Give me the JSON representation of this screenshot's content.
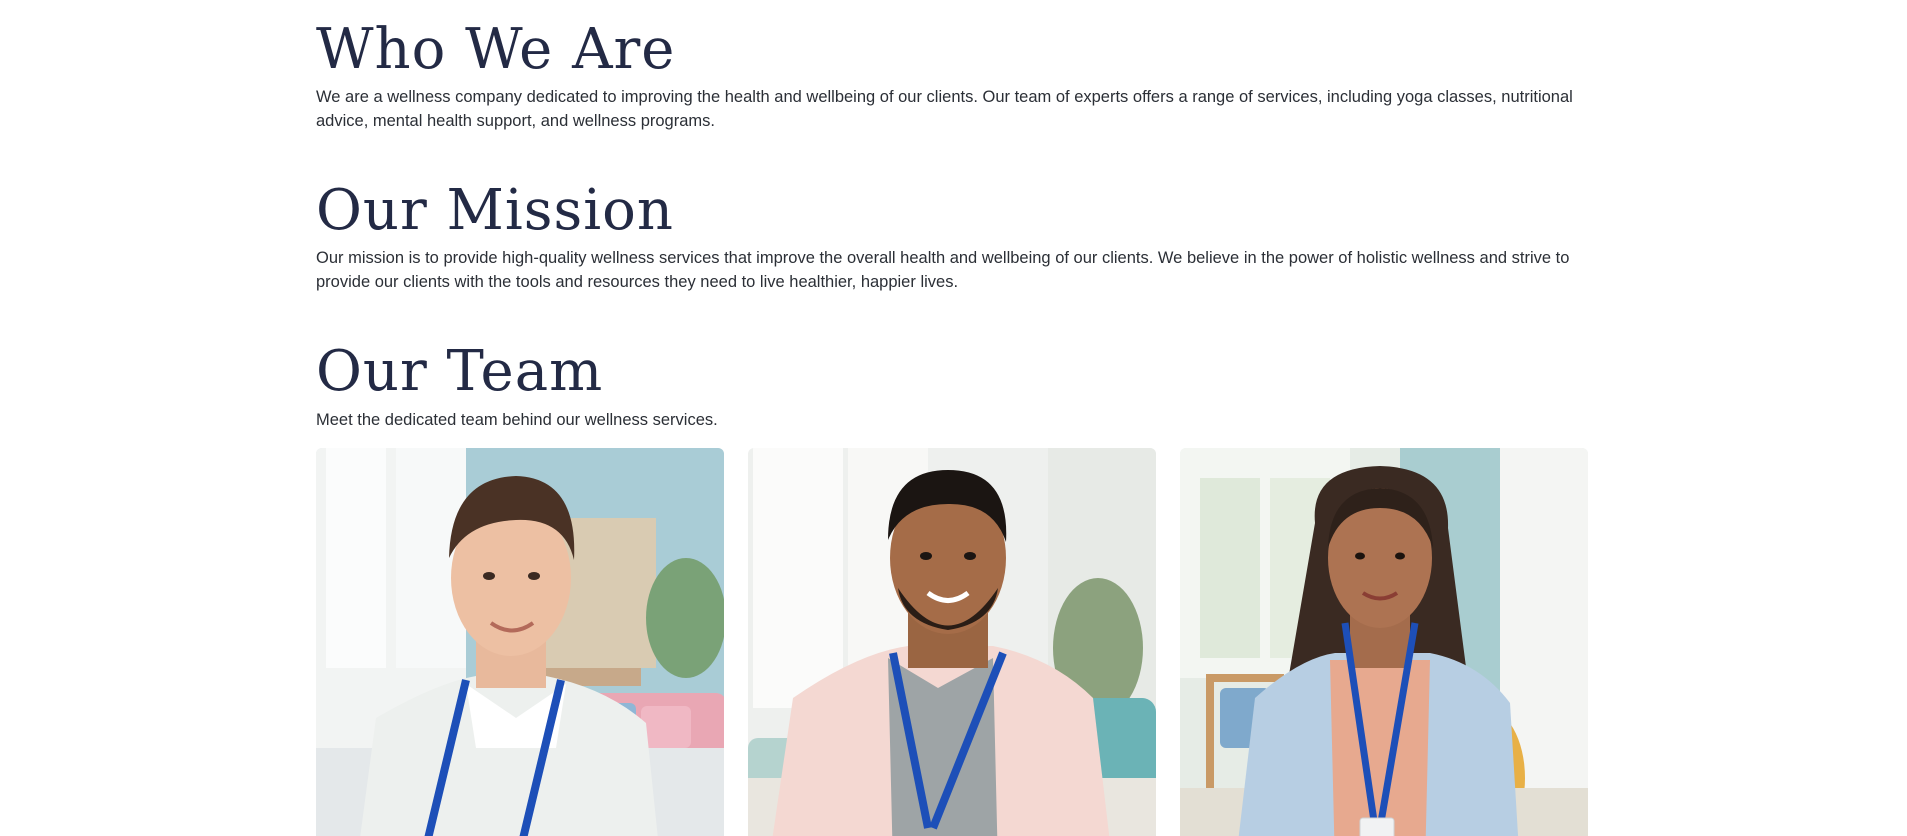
{
  "about": {
    "title": "Who We Are",
    "text": "We are a wellness company dedicated to improving the health and wellbeing of our clients. Our team of experts offers a range of services, including yoga classes, nutritional advice, mental health support, and wellness programs."
  },
  "mission": {
    "title": "Our Mission",
    "text": "Our mission is to provide high-quality wellness services that improve the overall health and wellbeing of our clients. We believe in the power of holistic wellness and strive to provide our clients with the tools and resources they need to live healthier, happier lives."
  },
  "team": {
    "title": "Our Team",
    "text": "Meet the dedicated team behind our wellness services."
  },
  "colors": {
    "heading": "#232a45",
    "body_text": "#2b2f36",
    "lanyard": "#1d4fb8"
  }
}
